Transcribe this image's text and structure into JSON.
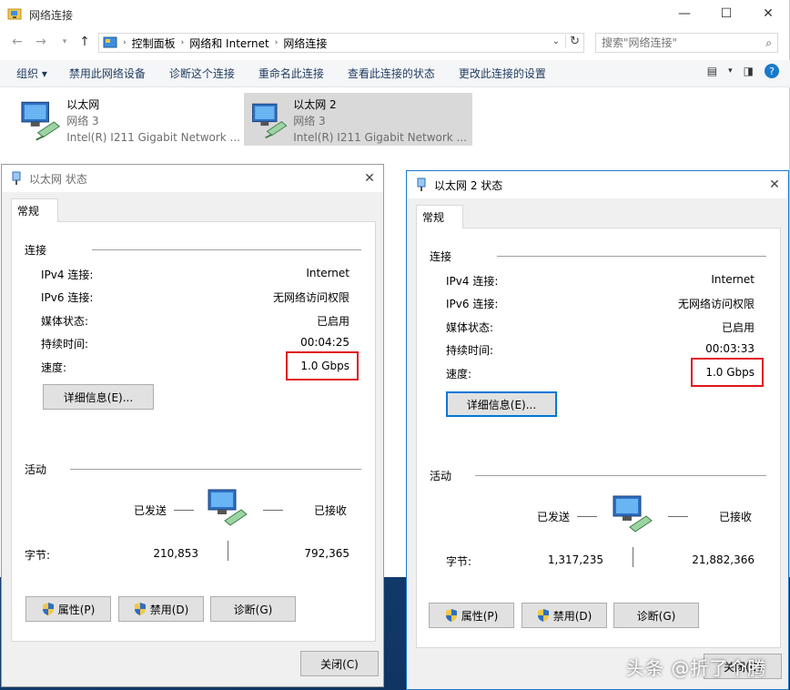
{
  "explorer": {
    "title": "网络连接",
    "breadcrumb": [
      "控制面板",
      "网络和 Internet",
      "网络连接"
    ],
    "search_placeholder": "搜索\"网络连接\"",
    "commands": [
      "组织 ▾",
      "禁用此网络设备",
      "诊断这个连接",
      "重命名此连接",
      "查看此连接的状态",
      "更改此连接的设置"
    ],
    "items": [
      {
        "name": "以太网",
        "network": "网络  3",
        "adapter": "Intel(R) I211 Gigabit Network ..."
      },
      {
        "name": "以太网 2",
        "network": "网络  3",
        "adapter": "Intel(R) I211 Gigabit Network ..."
      }
    ]
  },
  "dialogs": [
    {
      "title": "以太网 状态",
      "tab": "常规",
      "connection_label": "连接",
      "rows": [
        {
          "label": "IPv4 连接:",
          "value": "Internet"
        },
        {
          "label": "IPv6 连接:",
          "value": "无网络访问权限"
        },
        {
          "label": "媒体状态:",
          "value": "已启用"
        },
        {
          "label": "持续时间:",
          "value": "00:04:25"
        },
        {
          "label": "速度:",
          "value": "1.0 Gbps"
        }
      ],
      "details_button": "详细信息(E)...",
      "activity_label": "活动",
      "sent_label": "已发送",
      "received_label": "已接收",
      "bytes_label": "字节:",
      "bytes_sent": "210,853",
      "bytes_received": "792,365",
      "properties_button": "属性(P)",
      "disable_button": "禁用(D)",
      "diagnose_button": "诊断(G)",
      "close_button": "关闭(C)"
    },
    {
      "title": "以太网 2 状态",
      "tab": "常规",
      "connection_label": "连接",
      "rows": [
        {
          "label": "IPv4 连接:",
          "value": "Internet"
        },
        {
          "label": "IPv6 连接:",
          "value": "无网络访问权限"
        },
        {
          "label": "媒体状态:",
          "value": "已启用"
        },
        {
          "label": "持续时间:",
          "value": "00:03:33"
        },
        {
          "label": "速度:",
          "value": "1.0 Gbps"
        }
      ],
      "details_button": "详细信息(E)...",
      "activity_label": "活动",
      "sent_label": "已发送",
      "received_label": "已接收",
      "bytes_label": "字节:",
      "bytes_sent": "1,317,235",
      "bytes_received": "21,882,366",
      "properties_button": "属性(P)",
      "disable_button": "禁用(D)",
      "diagnose_button": "诊断(G)",
      "close_button": "关闭(C)"
    }
  ],
  "watermark": "头条 @折了个腾",
  "colors": {
    "highlight_box": "#e0161b",
    "focus_blue": "#0078d7",
    "selection_gray": "#d9d9d9"
  }
}
